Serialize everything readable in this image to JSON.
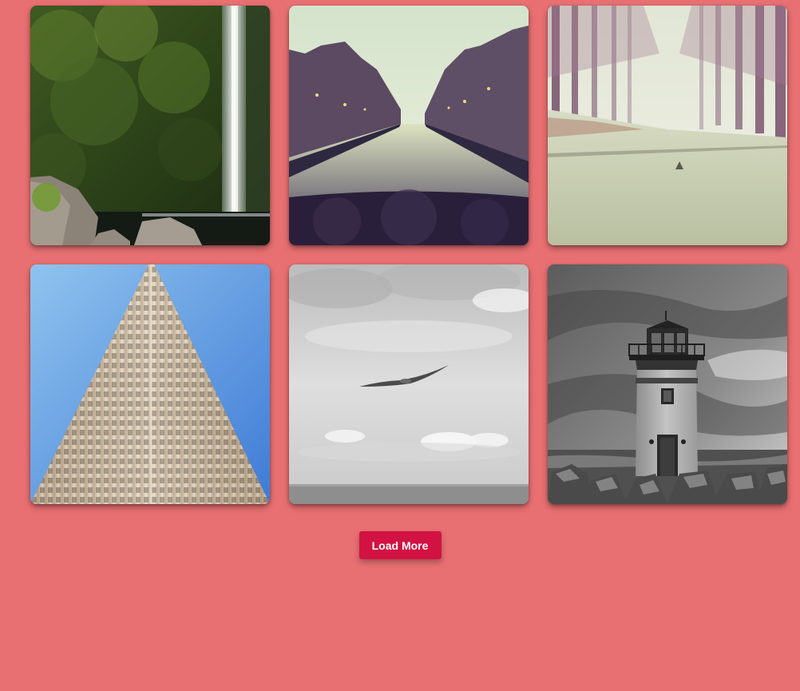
{
  "page": {
    "background": "#e97072"
  },
  "gallery": {
    "items": [
      {
        "icon": "waterfall-photo"
      },
      {
        "icon": "canal-city-photo"
      },
      {
        "icon": "forest-road-photo"
      },
      {
        "icon": "skyscraper-photo"
      },
      {
        "icon": "seagull-sky-photo"
      },
      {
        "icon": "lighthouse-photo"
      }
    ]
  },
  "load_more": {
    "label": "Load More",
    "color": "#d21242"
  }
}
